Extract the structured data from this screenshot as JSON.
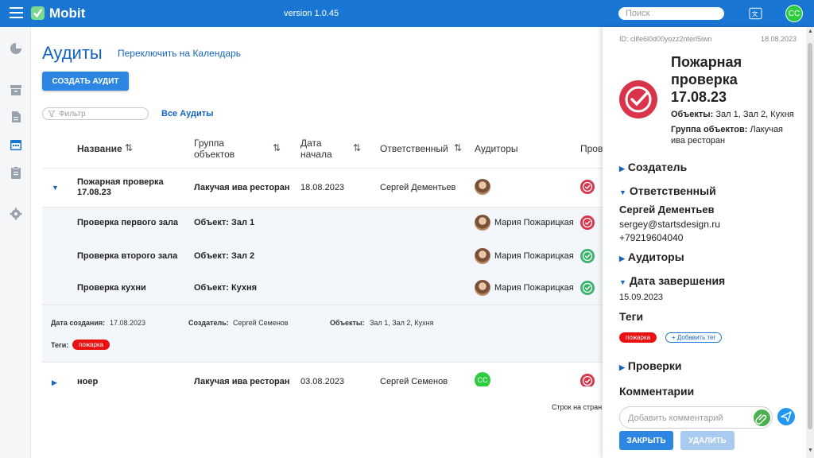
{
  "topbar": {
    "brand": "Mobit",
    "version": "version 1.0.45",
    "search_placeholder": "Поиск",
    "user_initials": "CC"
  },
  "colors": {
    "primary": "#1976d2",
    "link": "#1565c0",
    "status_red": "#d9344a",
    "status_green": "#38b56a",
    "tag_red": "#e81212"
  },
  "sidebar": {
    "items": [
      "chart-pie-icon",
      "archive-icon",
      "document-icon",
      "calendar-icon",
      "clipboard-icon",
      "settings-icon"
    ]
  },
  "main": {
    "title": "Аудиты",
    "switch_link": "Переключить на Календарь",
    "create_button": "СОЗДАТЬ АУДИТ",
    "filter_placeholder": "Фильтр",
    "all_audits": "Все Аудиты",
    "columns": {
      "name": "Название",
      "group": "Группа объектов",
      "start": "Дата начала",
      "responsible": "Ответственный",
      "auditors": "Аудиторы",
      "checks": "Пров"
    },
    "row1": {
      "name": "Пожарная проверка 17.08.23",
      "group": "Лакучая ива ресторан",
      "start": "18.08.2023",
      "responsible": "Сергей Дементьев"
    },
    "subrows": [
      {
        "name": "Проверка первого зала",
        "object": "Объект: Зал 1",
        "auditor": "Мария Пожарицкая",
        "status": "red"
      },
      {
        "name": "Проверка второго зала",
        "object": "Объект: Зал 2",
        "auditor": "Мария Пожарицкая",
        "status": "green"
      },
      {
        "name": "Проверка кухни",
        "object": "Объект: Кухня",
        "auditor": "Мария Пожарицкая",
        "status": "green"
      }
    ],
    "details": {
      "created_label": "Дата создания:",
      "created_value": "17.08.2023",
      "creator_label": "Создатель:",
      "creator_value": "Сергей Семенов",
      "objects_label": "Объекты:",
      "objects_value": "Зал 1, Зал 2, Кухня",
      "tags_label": "Теги:",
      "tag": "пожарка"
    },
    "row2": {
      "name": "ноер",
      "group": "Лакучая ива ресторан",
      "start": "03.08.2023",
      "responsible": "Сергей Семенов",
      "auditor_initials": "CC"
    },
    "pagination_label": "Строк на стран"
  },
  "drawer": {
    "id": "ID: cllfe6l0d00yozz2nterl5iwn",
    "date": "18.08.2023",
    "title": "Пожарная проверка 17.08.23",
    "objects_label": "Объекты:",
    "objects_value": "Зал 1, Зал 2, Кухня",
    "group_label": "Группа объектов:",
    "group_value": "Лакучая ива ресторан",
    "sections": {
      "creator": "Создатель",
      "responsible": "Ответственный",
      "auditors": "Аудиторы",
      "end_date": "Дата завершения",
      "tags": "Теги",
      "checks": "Проверки",
      "comments": "Комментарии"
    },
    "responsible_name": "Сергей Дементьев",
    "responsible_email": "sergey@startsdesign.ru",
    "responsible_phone": "+79219604040",
    "end_date_value": "15.09.2023",
    "tag": "пожарка",
    "add_tag": "+ Добавить тег",
    "comment_placeholder": "Добавить комментарий",
    "close_button": "ЗАКРЫТЬ",
    "delete_button": "УДАЛИТЬ"
  }
}
